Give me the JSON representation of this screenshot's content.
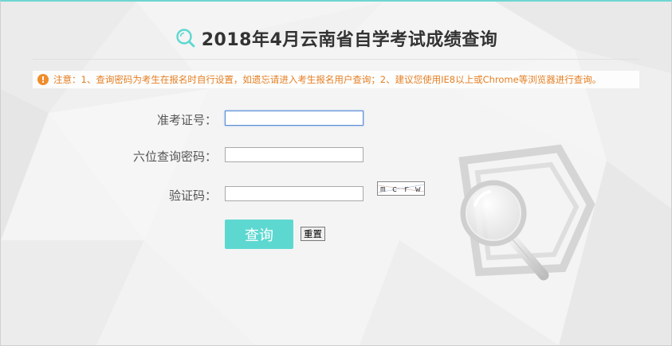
{
  "page": {
    "title": "2018年4月云南省自学考试成绩查询",
    "notice": "注意：1、查询密码为考生在报名时自行设置，如遗忘请进入考生报名用户查询；2、建议您使用IE8以上或Chrome等浏览器进行查询。"
  },
  "form": {
    "exam_id_label": "准考证号：",
    "exam_id_value": "",
    "password_label": "六位查询密码：",
    "password_value": "",
    "captcha_label": "验证码：",
    "captcha_value": "",
    "captcha_text": "mcrw",
    "query_button": "查询",
    "reset_button": "重置"
  },
  "icons": {
    "title_icon": "magnifier-outline-icon",
    "notice_icon": "exclamation-icon",
    "decoration": "magnifying-glass-icon"
  },
  "colors": {
    "accent": "#5dd8d0",
    "notice": "#e47f22",
    "notice_icon": "#ef8d2c",
    "title": "#333333"
  }
}
